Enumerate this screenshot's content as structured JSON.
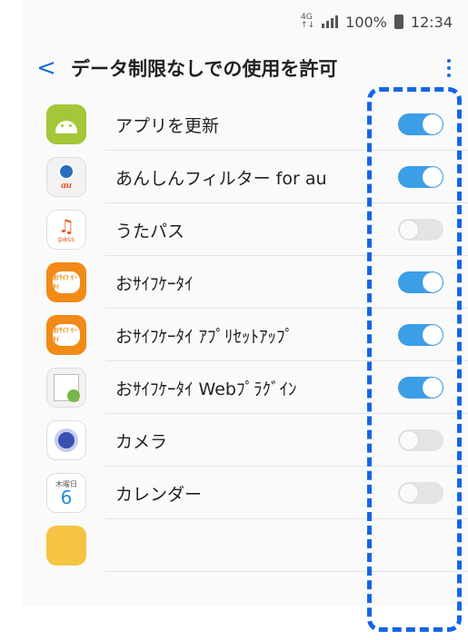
{
  "status_bar": {
    "network": "4G",
    "network_sub": "↑↓",
    "battery": "100%",
    "time": "12:34"
  },
  "header": {
    "back_label": "<",
    "title": "データ制限なしでの使用を許可",
    "more_icon": "more-vert-icon"
  },
  "apps": [
    {
      "name": "アプリを更新",
      "icon": "android-icon",
      "enabled": true
    },
    {
      "name": "あんしんフィルター for au",
      "icon": "anshin-filter-icon",
      "enabled": true
    },
    {
      "name": "うたパス",
      "icon": "utapass-icon",
      "enabled": false
    },
    {
      "name": "おｻｲﾌｹｰﾀｲ",
      "icon": "osaifu-icon",
      "enabled": true
    },
    {
      "name": "おｻｲﾌｹｰﾀｲ ｱﾌﾟﾘｾｯﾄｱｯﾌﾟ",
      "icon": "osaifu-setup-icon",
      "enabled": true
    },
    {
      "name": "おｻｲﾌｹｰﾀｲ Webﾌﾟﾗｸﾞｲﾝ",
      "icon": "osaifu-web-icon",
      "enabled": true
    },
    {
      "name": "カメラ",
      "icon": "camera-icon",
      "enabled": false
    },
    {
      "name": "カレンダー",
      "icon": "calendar-icon",
      "enabled": false
    }
  ],
  "icon_text": {
    "au": "au",
    "pass": "pass",
    "osaifu": "おｻｲﾌ ｹｰﾀｲ",
    "cal_weekday": "木曜日",
    "cal_day": "6"
  },
  "colors": {
    "accent": "#1a6fd8",
    "toggle_on": "#3c9ee6",
    "toggle_off": "#e4e4e4",
    "highlight": "#1565e8"
  }
}
